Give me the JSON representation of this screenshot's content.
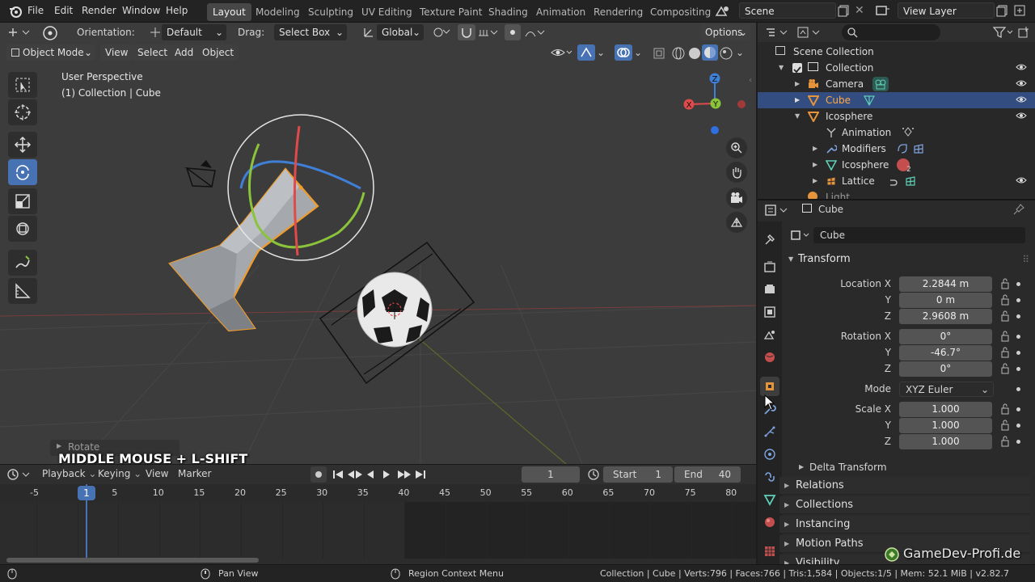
{
  "topbar": {
    "menus": [
      "File",
      "Edit",
      "Render",
      "Window",
      "Help"
    ],
    "workspaces": [
      "Layout",
      "Modeling",
      "Sculpting",
      "UV Editing",
      "Texture Paint",
      "Shading",
      "Animation",
      "Rendering",
      "Compositing"
    ],
    "active_workspace": "Layout",
    "scene": "Scene",
    "view_layer": "View Layer"
  },
  "viewport_header": {
    "orientation_label": "Orientation:",
    "orientation_value": "Default",
    "drag_label": "Drag:",
    "drag_value": "Select Box",
    "transform_space": "Global",
    "options": "Options",
    "mode": "Object Mode",
    "menus": [
      "View",
      "Select",
      "Add",
      "Object"
    ]
  },
  "viewport": {
    "perspective": "User Perspective",
    "context": "(1) Collection | Cube",
    "gizmo_axes": [
      "Z",
      "Y",
      "X"
    ],
    "last_operator": "Rotate",
    "key_hint": "MIDDLE MOUSE + L-SHIFT"
  },
  "timeline": {
    "menus": [
      "Playback",
      "Keying",
      "View",
      "Marker"
    ],
    "current_frame": "1",
    "start_label": "Start",
    "start_value": "1",
    "end_label": "End",
    "end_value": "40",
    "ruler": [
      "-5",
      "1",
      "5",
      "10",
      "15",
      "20",
      "25",
      "30",
      "35",
      "40",
      "45",
      "50",
      "55",
      "60",
      "65",
      "70",
      "75",
      "80"
    ]
  },
  "outliner": {
    "root": "Scene Collection",
    "collection": "Collection",
    "items": [
      {
        "name": "Camera",
        "selected": false
      },
      {
        "name": "Cube",
        "selected": true
      },
      {
        "name": "Icosphere",
        "selected": false
      }
    ],
    "children": [
      "Animation",
      "Modifiers",
      "Icosphere",
      "Lattice"
    ],
    "modifier_badge": "2",
    "partial_item": "Light"
  },
  "properties": {
    "object_title": "Cube",
    "object_name": "Cube",
    "transform_panel": "Transform",
    "location_label": "Location X",
    "location": [
      "2.2844 m",
      "0 m",
      "2.9608 m"
    ],
    "rotation_label": "Rotation X",
    "rotation": [
      "0°",
      "-46.7°",
      "0°"
    ],
    "axis_y": "Y",
    "axis_z": "Z",
    "mode_label": "Mode",
    "mode_value": "XYZ Euler",
    "scale_label": "Scale X",
    "scale": [
      "1.000",
      "1.000",
      "1.000"
    ],
    "delta_transform": "Delta Transform",
    "panels": [
      "Relations",
      "Collections",
      "Instancing",
      "Motion Paths",
      "Visibility"
    ]
  },
  "statusbar": {
    "left_hint": "Pan View",
    "right_hint": "Region Context Menu",
    "stats": "Collection | Cube | Verts:796 | Faces:766 | Tris:1,584 | Objects:1/5 | Mem: 52.1 MiB | v2.82.7"
  },
  "watermark": "GameDev-Profi.de",
  "colors": {
    "accent": "#4772b3",
    "selection_orange": "#ffaa44",
    "axis_x": "#e04a4a",
    "axis_y": "#8bc33a",
    "axis_z": "#3f7fd6"
  }
}
